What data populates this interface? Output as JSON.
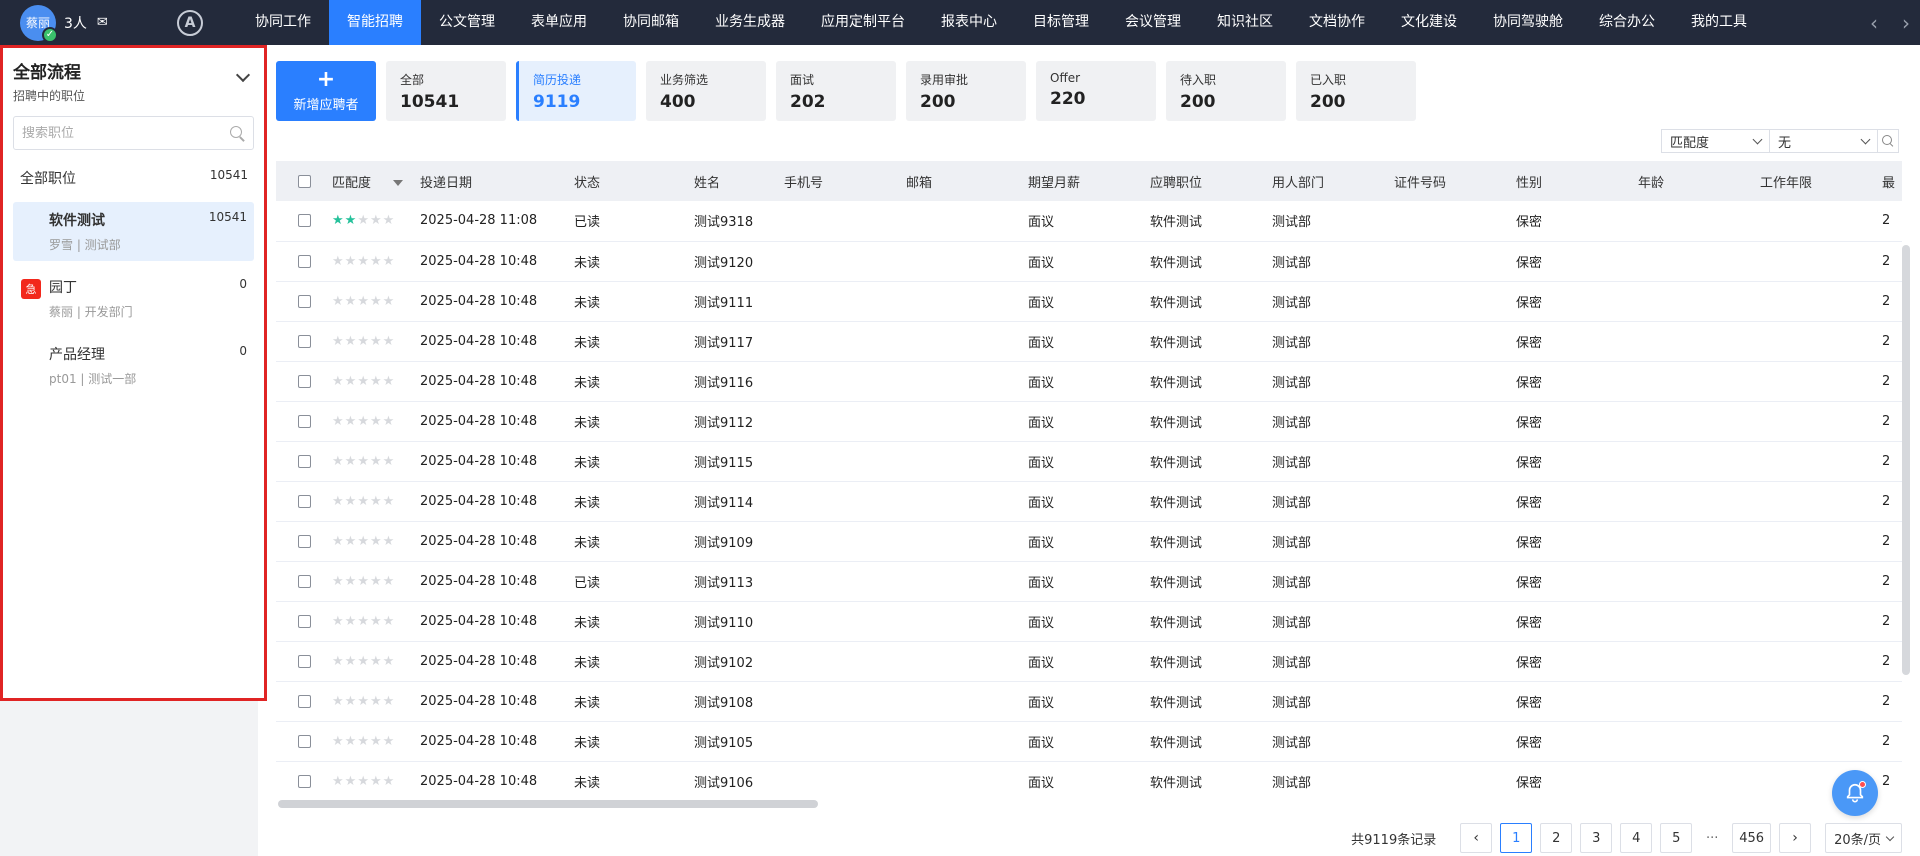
{
  "user": {
    "name": "蔡丽",
    "online_count": "3人"
  },
  "nav": {
    "items": [
      "协同工作",
      "智能招聘",
      "公文管理",
      "表单应用",
      "协同邮箱",
      "业务生成器",
      "应用定制平台",
      "报表中心",
      "目标管理",
      "会议管理",
      "知识社区",
      "文档协作",
      "文化建设",
      "协同驾驶舱",
      "综合办公",
      "我的工具"
    ],
    "active_index": 1,
    "prev_arrow": "‹",
    "next_arrow": "›"
  },
  "sidebar": {
    "title": "全部流程",
    "subtitle": "招聘中的职位",
    "search_placeholder": "搜索职位",
    "all_label": "全部职位",
    "all_count": "10541",
    "jobs": [
      {
        "title": "软件测试",
        "count": "10541",
        "meta": "罗雪 | 测试部",
        "selected": true,
        "urgent": ""
      },
      {
        "title": "园丁",
        "count": "0",
        "meta": "蔡丽 | 开发部门",
        "selected": false,
        "urgent": "急"
      },
      {
        "title": "产品经理",
        "count": "0",
        "meta": "pt01 | 测试一部",
        "selected": false,
        "urgent": ""
      }
    ]
  },
  "add_button": {
    "plus": "+",
    "label": "新增应聘者"
  },
  "stages": [
    {
      "label": "全部",
      "count": "10541"
    },
    {
      "label": "简历投递",
      "count": "9119",
      "active": true
    },
    {
      "label": "业务筛选",
      "count": "400"
    },
    {
      "label": "面试",
      "count": "202"
    },
    {
      "label": "录用审批",
      "count": "200"
    },
    {
      "label": "Offer",
      "count": "220"
    },
    {
      "label": "待入职",
      "count": "200"
    },
    {
      "label": "已入职",
      "count": "200"
    }
  ],
  "sort": {
    "field": "匹配度",
    "value": "无"
  },
  "table": {
    "headers": [
      "匹配度",
      "投递日期",
      "状态",
      "姓名",
      "手机号",
      "邮箱",
      "期望月薪",
      "应聘职位",
      "用人部门",
      "证件号码",
      "性别",
      "年龄",
      "工作年限",
      "最"
    ],
    "rows": [
      {
        "stars": 2,
        "date": "2025-04-28 11:08",
        "status": "已读",
        "name": "测试9318",
        "phone": "",
        "email": "",
        "salary": "面议",
        "position": "软件测试",
        "dept": "测试部",
        "id": "",
        "gender": "保密",
        "age": "",
        "years": "",
        "last": "2"
      },
      {
        "stars": 0,
        "date": "2025-04-28 10:48",
        "status": "未读",
        "name": "测试9120",
        "phone": "",
        "email": "",
        "salary": "面议",
        "position": "软件测试",
        "dept": "测试部",
        "id": "",
        "gender": "保密",
        "age": "",
        "years": "",
        "last": "2"
      },
      {
        "stars": 0,
        "date": "2025-04-28 10:48",
        "status": "未读",
        "name": "测试9111",
        "phone": "",
        "email": "",
        "salary": "面议",
        "position": "软件测试",
        "dept": "测试部",
        "id": "",
        "gender": "保密",
        "age": "",
        "years": "",
        "last": "2"
      },
      {
        "stars": 0,
        "date": "2025-04-28 10:48",
        "status": "未读",
        "name": "测试9117",
        "phone": "",
        "email": "",
        "salary": "面议",
        "position": "软件测试",
        "dept": "测试部",
        "id": "",
        "gender": "保密",
        "age": "",
        "years": "",
        "last": "2"
      },
      {
        "stars": 0,
        "date": "2025-04-28 10:48",
        "status": "未读",
        "name": "测试9116",
        "phone": "",
        "email": "",
        "salary": "面议",
        "position": "软件测试",
        "dept": "测试部",
        "id": "",
        "gender": "保密",
        "age": "",
        "years": "",
        "last": "2"
      },
      {
        "stars": 0,
        "date": "2025-04-28 10:48",
        "status": "未读",
        "name": "测试9112",
        "phone": "",
        "email": "",
        "salary": "面议",
        "position": "软件测试",
        "dept": "测试部",
        "id": "",
        "gender": "保密",
        "age": "",
        "years": "",
        "last": "2"
      },
      {
        "stars": 0,
        "date": "2025-04-28 10:48",
        "status": "未读",
        "name": "测试9115",
        "phone": "",
        "email": "",
        "salary": "面议",
        "position": "软件测试",
        "dept": "测试部",
        "id": "",
        "gender": "保密",
        "age": "",
        "years": "",
        "last": "2"
      },
      {
        "stars": 0,
        "date": "2025-04-28 10:48",
        "status": "未读",
        "name": "测试9114",
        "phone": "",
        "email": "",
        "salary": "面议",
        "position": "软件测试",
        "dept": "测试部",
        "id": "",
        "gender": "保密",
        "age": "",
        "years": "",
        "last": "2"
      },
      {
        "stars": 0,
        "date": "2025-04-28 10:48",
        "status": "未读",
        "name": "测试9109",
        "phone": "",
        "email": "",
        "salary": "面议",
        "position": "软件测试",
        "dept": "测试部",
        "id": "",
        "gender": "保密",
        "age": "",
        "years": "",
        "last": "2"
      },
      {
        "stars": 0,
        "date": "2025-04-28 10:48",
        "status": "已读",
        "name": "测试9113",
        "phone": "",
        "email": "",
        "salary": "面议",
        "position": "软件测试",
        "dept": "测试部",
        "id": "",
        "gender": "保密",
        "age": "",
        "years": "",
        "last": "2"
      },
      {
        "stars": 0,
        "date": "2025-04-28 10:48",
        "status": "未读",
        "name": "测试9110",
        "phone": "",
        "email": "",
        "salary": "面议",
        "position": "软件测试",
        "dept": "测试部",
        "id": "",
        "gender": "保密",
        "age": "",
        "years": "",
        "last": "2"
      },
      {
        "stars": 0,
        "date": "2025-04-28 10:48",
        "status": "未读",
        "name": "测试9102",
        "phone": "",
        "email": "",
        "salary": "面议",
        "position": "软件测试",
        "dept": "测试部",
        "id": "",
        "gender": "保密",
        "age": "",
        "years": "",
        "last": "2"
      },
      {
        "stars": 0,
        "date": "2025-04-28 10:48",
        "status": "未读",
        "name": "测试9108",
        "phone": "",
        "email": "",
        "salary": "面议",
        "position": "软件测试",
        "dept": "测试部",
        "id": "",
        "gender": "保密",
        "age": "",
        "years": "",
        "last": "2"
      },
      {
        "stars": 0,
        "date": "2025-04-28 10:48",
        "status": "未读",
        "name": "测试9105",
        "phone": "",
        "email": "",
        "salary": "面议",
        "position": "软件测试",
        "dept": "测试部",
        "id": "",
        "gender": "保密",
        "age": "",
        "years": "",
        "last": "2"
      },
      {
        "stars": 0,
        "date": "2025-04-28 10:48",
        "status": "未读",
        "name": "测试9106",
        "phone": "",
        "email": "",
        "salary": "面议",
        "position": "软件测试",
        "dept": "测试部",
        "id": "",
        "gender": "保密",
        "age": "",
        "years": "",
        "last": "2"
      }
    ]
  },
  "pagination": {
    "total": "共9119条记录",
    "pages": [
      "1",
      "2",
      "3",
      "4",
      "5"
    ],
    "current": "1",
    "ellipsis": "···",
    "last_page": "456",
    "prev": "‹",
    "next": "›",
    "page_size": "20条/页"
  },
  "colors": {
    "nav_bg": "#232a3b",
    "accent": "#2a7fff",
    "star_on": "#25c19b",
    "urgent": "#f2281c",
    "highlight_border": "#e02424"
  }
}
